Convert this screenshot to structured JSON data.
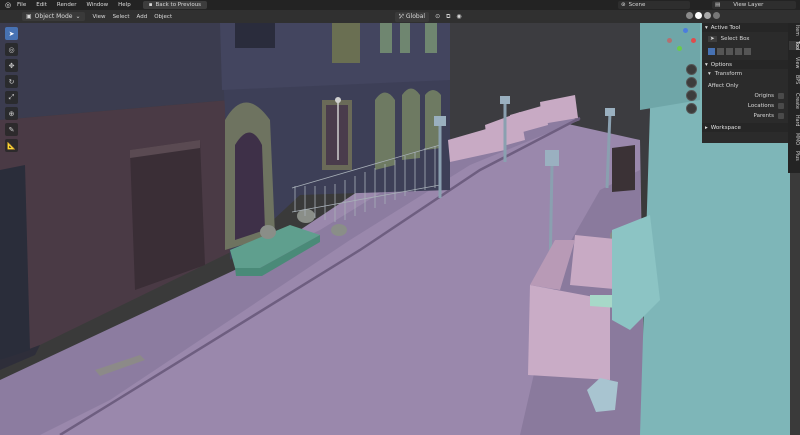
{
  "topbar": {
    "menus": [
      "File",
      "Edit",
      "Render",
      "Window",
      "Help"
    ],
    "back_button": "Back to Previous",
    "scene": "Scene",
    "view_layer": "View Layer"
  },
  "header": {
    "mode": "Object Mode",
    "menus": [
      "View",
      "Select",
      "Add",
      "Object"
    ],
    "orientation": "Global"
  },
  "npanel": {
    "active_tool_title": "Active Tool",
    "tool_name": "Select Box",
    "options_title": "Options",
    "transform_title": "Transform",
    "affect_only": "Affect Only",
    "origins": "Origins",
    "locations": "Locations",
    "parents": "Parents",
    "workspace_title": "Workspace",
    "tabs": [
      "Item",
      "Tool",
      "View",
      "BPS",
      "Create",
      "Hard",
      "MMO",
      "Plus"
    ]
  },
  "colors": {
    "accent": "#4772b3",
    "street": "#9a88ac",
    "building": "#4a4a6a",
    "teal_building": "#7eb6b8"
  },
  "icons": [
    "blender-logo",
    "select-box-icon",
    "cursor-icon",
    "move-icon",
    "rotate-icon",
    "scale-icon",
    "transform-icon",
    "annotate-icon",
    "measure-icon",
    "zoom-icon",
    "pan-icon",
    "camera-icon",
    "perspective-icon"
  ]
}
